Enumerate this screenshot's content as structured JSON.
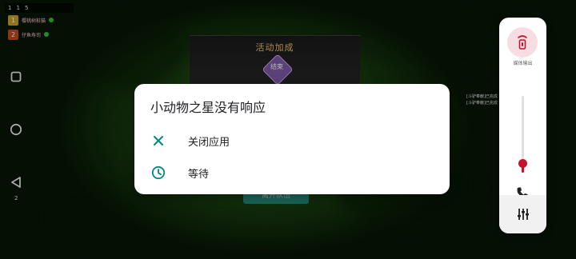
{
  "game": {
    "hud_stats": [
      "1",
      "1",
      "5"
    ],
    "players": [
      {
        "rank": "1",
        "name": "樱桃树桩猫",
        "color": "#c9a227"
      },
      {
        "rank": "2",
        "name": "仔鱼寿司",
        "color": "#c24a1a"
      }
    ],
    "event_title": "活动加成",
    "event_badge": "结束",
    "action_button": "离开队伍",
    "right_notes": [
      "[斗驴奉献]已完成",
      "[斗驴奉献]已完成"
    ],
    "side_count": "2"
  },
  "dialog": {
    "title": "小动物之星没有响应",
    "options": [
      {
        "label": "关闭应用",
        "icon": "close-icon"
      },
      {
        "label": "等待",
        "icon": "clock-icon"
      }
    ]
  },
  "volume_panel": {
    "output_label": "媒体输出",
    "level": 0.13,
    "accent": "#c8102e",
    "icons": [
      "speaker-output-icon",
      "phone-icon",
      "equalizer-icon"
    ]
  },
  "nav": {
    "icons": [
      "recents-icon",
      "home-icon",
      "back-icon"
    ]
  }
}
